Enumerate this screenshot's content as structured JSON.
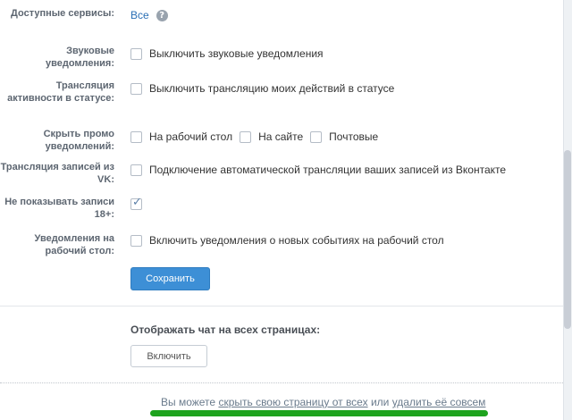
{
  "settings": {
    "services": {
      "label": "Доступные сервисы:",
      "value": "Все",
      "help_icon": "?"
    },
    "sound": {
      "label": "Звуковые уведомления:",
      "option": "Выключить звуковые уведомления"
    },
    "broadcast": {
      "label": "Трансляция активности в статусе:",
      "option": "Выключить трансляцию моих действий в статусе"
    },
    "promo": {
      "label": "Скрыть промо уведомлений:",
      "options": [
        "На рабочий стол",
        "На сайте",
        "Почтовые"
      ]
    },
    "vk": {
      "label": "Трансляция записей из VK:",
      "option": "Подключение автоматической трансляции ваших записей из Вконтакте"
    },
    "adult": {
      "label": "Не показывать записи 18+:",
      "checked": true
    },
    "desktop": {
      "label": "Уведомления на рабочий стол:",
      "option": "Включить уведомления о новых событиях на рабочий стол"
    },
    "save_label": "Сохранить"
  },
  "chat": {
    "title": "Отображать чат на всех страницах:",
    "button_label": "Включить"
  },
  "footer": {
    "prefix": "Вы можете",
    "hide_link": "скрыть свою страницу от всех",
    "middle": "или",
    "delete_link": "удалить её совсем"
  },
  "colors": {
    "accent": "#3d8fd6",
    "highlight": "#1ea31e"
  }
}
